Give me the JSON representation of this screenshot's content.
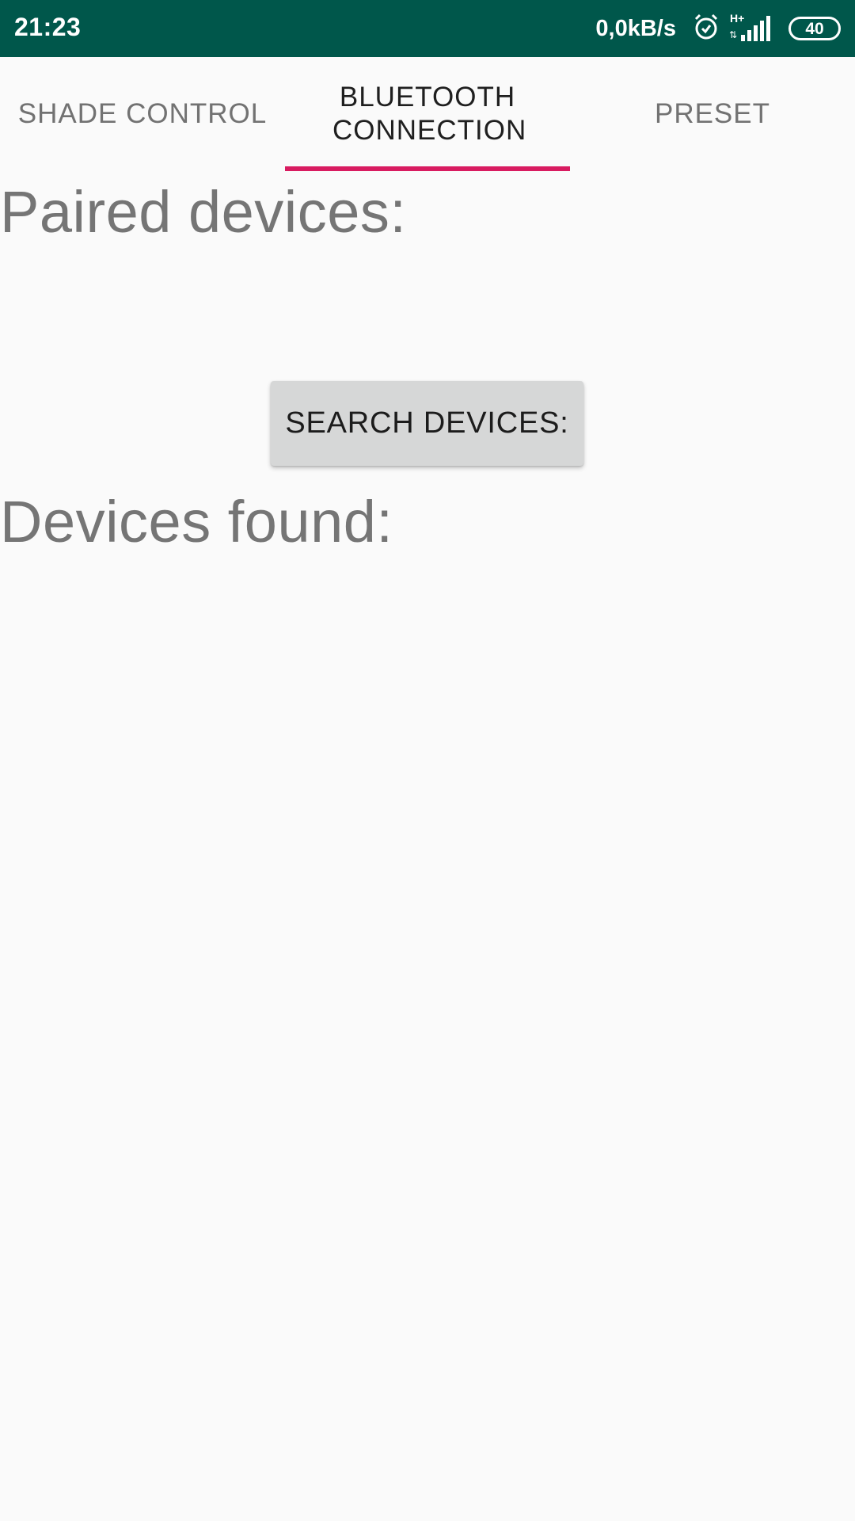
{
  "status_bar": {
    "time": "21:23",
    "network_speed": "0,0kB/s",
    "network_type": "H+",
    "battery": "40",
    "icons": [
      "alarm-icon",
      "signal-icon",
      "battery-icon"
    ],
    "background": "#00574b"
  },
  "tabs": [
    {
      "label": "SHADE CONTROL",
      "active": false
    },
    {
      "label": "BLUETOOTH CONNECTION",
      "active": true
    },
    {
      "label": "PRESET",
      "active": false
    }
  ],
  "tab_indicator_color": "#d81b60",
  "paired_devices": {
    "heading": "Paired devices:"
  },
  "search_button": {
    "label": "SEARCH DEVICES:"
  },
  "devices_found": {
    "heading": "Devices found:"
  }
}
